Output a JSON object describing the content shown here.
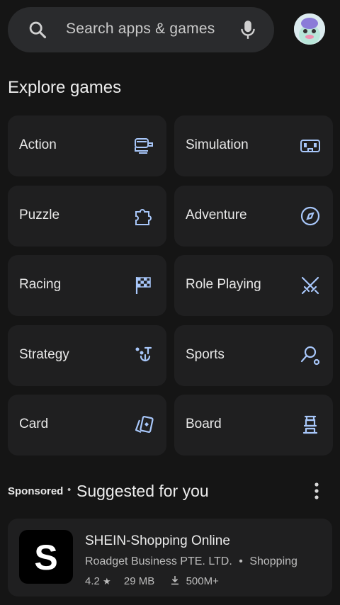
{
  "search": {
    "placeholder": "Search apps & games"
  },
  "explore": {
    "title": "Explore games",
    "categories": [
      {
        "label": "Action",
        "icon": "action-game-icon"
      },
      {
        "label": "Simulation",
        "icon": "simulation-game-icon"
      },
      {
        "label": "Puzzle",
        "icon": "puzzle-icon"
      },
      {
        "label": "Adventure",
        "icon": "compass-icon"
      },
      {
        "label": "Racing",
        "icon": "checkered-flag-icon"
      },
      {
        "label": "Role Playing",
        "icon": "crossed-swords-icon"
      },
      {
        "label": "Strategy",
        "icon": "strategy-icon"
      },
      {
        "label": "Sports",
        "icon": "sports-icon"
      },
      {
        "label": "Card",
        "icon": "cards-icon"
      },
      {
        "label": "Board",
        "icon": "board-game-icon"
      }
    ]
  },
  "suggested": {
    "sponsored": "Sponsored",
    "separator": "•",
    "title": "Suggested for you",
    "app": {
      "icon_letter": "S",
      "name": "SHEIN-Shopping Online",
      "developer": "Roadget Business PTE. LTD.",
      "category": "Shopping",
      "rating": "4.2",
      "size": "29 MB",
      "downloads": "500M+"
    }
  },
  "colors": {
    "background": "#151515",
    "tile": "#1f1f20",
    "icon_accent": "#a8c7fa"
  }
}
